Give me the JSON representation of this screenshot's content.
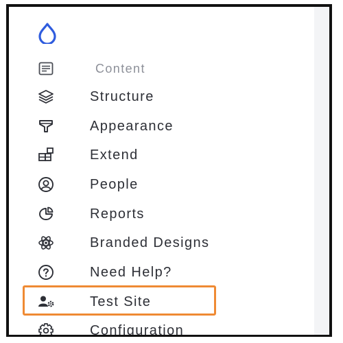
{
  "sidebar": {
    "logo_icon": "drupal-drop-icon",
    "accent_color": "#2f5cde",
    "highlight_color": "#ef8a33",
    "items": [
      {
        "label": "Content",
        "icon": "document-icon",
        "muted": true
      },
      {
        "label": "Structure",
        "icon": "layers-icon"
      },
      {
        "label": "Appearance",
        "icon": "paint-roller-icon"
      },
      {
        "label": "Extend",
        "icon": "puzzle-blocks-icon"
      },
      {
        "label": "People",
        "icon": "user-circle-icon"
      },
      {
        "label": "Reports",
        "icon": "pie-chart-icon"
      },
      {
        "label": "Branded Designs",
        "icon": "atom-icon"
      },
      {
        "label": "Need Help?",
        "icon": "question-circle-icon"
      },
      {
        "label": "Test Site",
        "icon": "user-gear-icon",
        "highlighted": true
      },
      {
        "label": "Configuration",
        "icon": "gear-icon"
      }
    ]
  }
}
